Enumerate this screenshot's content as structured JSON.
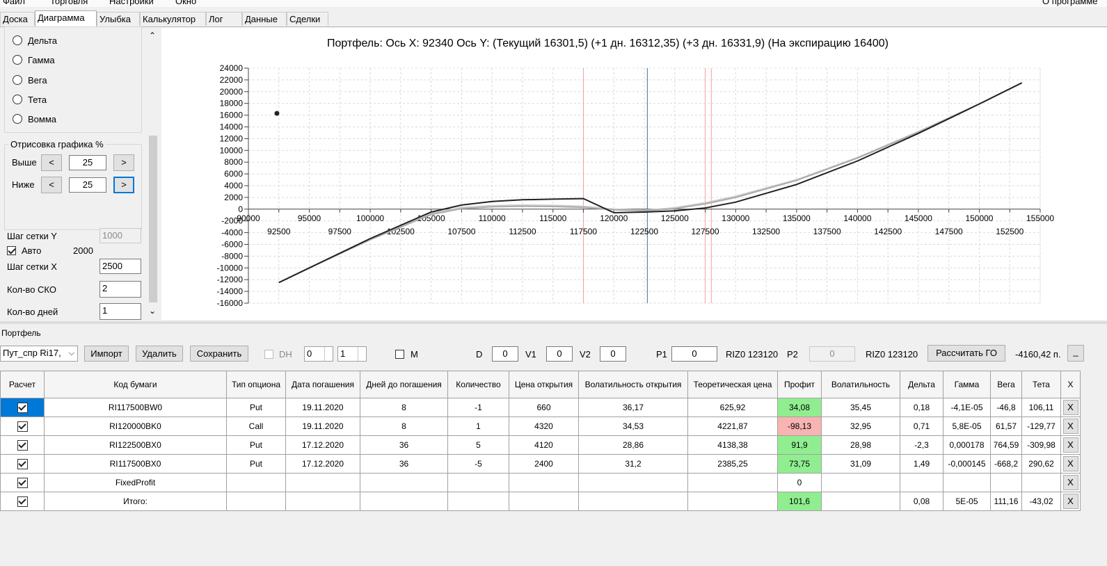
{
  "menu": {
    "file": "Файл",
    "trade": "Торговля",
    "settings": "Настройки",
    "window": "Окно",
    "about": "О программе"
  },
  "tabs": [
    "Доска",
    "Диаграмма",
    "Улыбка",
    "Калькулятор",
    "Лог",
    "Данные",
    "Сделки"
  ],
  "active_tab": "Диаграмма",
  "left": {
    "radios": [
      "Дельта",
      "Гамма",
      "Вега",
      "Тета",
      "Вомма"
    ],
    "render_group": "Отрисовка графика %",
    "above_label": "Выше",
    "below_label": "Ниже",
    "above_value": "25",
    "below_value": "25",
    "prev": "<",
    "next": ">",
    "grid_y_label": "Шаг сетки Y",
    "grid_y_value": "1000",
    "auto_label": "Авто",
    "auto_value": "2000",
    "grid_x_label": "Шаг сетки X",
    "grid_x_value": "2500",
    "sko_label": "Кол-во СКО",
    "sko_value": "2",
    "days_label": "Кол-во дней",
    "days_value": "1"
  },
  "chart": {
    "title": "Портфель: Ось X: 92340 Ось Y:  (Текущий 16301,5)  (+1 дн. 16312,35)  (+3 дн. 16331,9)  (На экспирацию 16400)"
  },
  "chart_data": {
    "type": "line",
    "title": "Портфель: Ось X: 92340 Ось Y:  (Текущий 16301,5)  (+1 дн. 16312,35)  (+3 дн. 16331,9)  (На экспирацию 16400)",
    "xlim": [
      90000,
      155000
    ],
    "ylim": [
      -16000,
      24000
    ],
    "x_ticks_top": [
      90000,
      95000,
      100000,
      105000,
      110000,
      115000,
      120000,
      125000,
      130000,
      135000,
      140000,
      145000,
      150000,
      155000
    ],
    "x_ticks_bottom": [
      92500,
      97500,
      102500,
      107500,
      112500,
      117500,
      122500,
      127500,
      132500,
      137500,
      142500,
      147500,
      152500
    ],
    "y_ticks": [
      24000,
      22000,
      20000,
      18000,
      16000,
      14000,
      12000,
      10000,
      8000,
      6000,
      4000,
      2000,
      0,
      -2000,
      -4000,
      -6000,
      -8000,
      -10000,
      -12000,
      -14000,
      -16000
    ],
    "grid": true,
    "point": {
      "x": 92340,
      "y": 16301.5
    },
    "vlines": [
      {
        "x": 117500,
        "color": "#f4a0a0"
      },
      {
        "x": 122750,
        "color": "#4a6d9c"
      },
      {
        "x": 127500,
        "color": "#f4a0a0"
      },
      {
        "x": 128000,
        "color": "#f4a0a0"
      }
    ],
    "series": [
      {
        "color": "#222222",
        "x": [
          92500,
          95000,
          100000,
          105000,
          107500,
          110000,
          112500,
          115000,
          117500,
          120000,
          122500,
          125000,
          127500,
          130000,
          135000,
          140000,
          145000,
          150000,
          153500
        ],
        "y": [
          -12500,
          -10000,
          -5000,
          -500,
          700,
          1300,
          1600,
          1700,
          1800,
          -600,
          -500,
          -300,
          200,
          1200,
          4200,
          8200,
          12900,
          17900,
          21500
        ]
      },
      {
        "color": "#aaaaaa",
        "x": [
          92500,
          95000,
          100000,
          105000,
          107500,
          110000,
          112500,
          115000,
          117500,
          120000,
          122500,
          125000,
          127500,
          130000,
          135000,
          140000,
          145000,
          150000,
          153500
        ],
        "y": [
          -12500,
          -10000,
          -5200,
          -900,
          100,
          400,
          500,
          450,
          300,
          -100,
          -300,
          100,
          900,
          2000,
          4900,
          8700,
          13100,
          17900,
          21500
        ]
      },
      {
        "color": "#cfcfcf",
        "x": [
          92500,
          95000,
          100000,
          105000,
          107500,
          110000,
          112500,
          115000,
          117500,
          120000,
          122500,
          125000,
          127500,
          130000,
          135000,
          140000,
          145000,
          150000,
          153500
        ],
        "y": [
          -12500,
          -10000,
          -5100,
          -700,
          300,
          600,
          700,
          650,
          500,
          0,
          -200,
          250,
          1100,
          2200,
          5000,
          8800,
          13200,
          17900,
          21500
        ]
      }
    ]
  },
  "portfolio": {
    "group_label": "Портфель",
    "select_value": "Пут_спр Ri17,",
    "import": "Импорт",
    "delete": "Удалить",
    "save": "Сохранить",
    "dh_label": "DH",
    "dh_a": "0",
    "dh_b": "1",
    "m_label": "M",
    "d_label": "D",
    "d_value": "0",
    "v1_label": "V1",
    "v1_value": "0",
    "v2_label": "V2",
    "v2_value": "0",
    "p1_label": "P1",
    "p1_value": "0",
    "riz1": "RIZ0 123120",
    "p2_label": "P2",
    "p2_value": "0",
    "riz2": "RIZ0 123120",
    "calc_go": "Рассчитать ГО",
    "go_value": "-4160,42 п.",
    "more": "_"
  },
  "table": {
    "headers": [
      "Расчет",
      "Код бумаги",
      "Тип опциона",
      "Дата погашения",
      "Дней до погашения",
      "Количество",
      "Цена открытия",
      "Волатильность открытия",
      "Теоретическая цена",
      "Профит",
      "Волатильность",
      "Дельта",
      "Гамма",
      "Вега",
      "Тета",
      "X"
    ],
    "rows": [
      {
        "code": "RI117500BW0",
        "type": "Put",
        "date": "19.11.2020",
        "days": "8",
        "qty": "-1",
        "price": "660",
        "vol_open": "36,17",
        "theo": "625,92",
        "profit": "34,08",
        "profit_color": "green",
        "vol": "35,45",
        "delta": "0,18",
        "gamma": "-4,1E-05",
        "vega": "-46,8",
        "theta": "106,11",
        "x": "X"
      },
      {
        "code": "RI120000BK0",
        "type": "Call",
        "date": "19.11.2020",
        "days": "8",
        "qty": "1",
        "price": "4320",
        "vol_open": "34,53",
        "theo": "4221,87",
        "profit": "-98,13",
        "profit_color": "red",
        "vol": "32,95",
        "delta": "0,71",
        "gamma": "5,8E-05",
        "vega": "61,57",
        "theta": "-129,77",
        "x": "X"
      },
      {
        "code": "RI122500BX0",
        "type": "Put",
        "date": "17.12.2020",
        "days": "36",
        "qty": "5",
        "price": "4120",
        "vol_open": "28,86",
        "theo": "4138,38",
        "profit": "91,9",
        "profit_color": "green",
        "vol": "28,98",
        "delta": "-2,3",
        "gamma": "0,000178",
        "vega": "764,59",
        "theta": "-309,98",
        "x": "X"
      },
      {
        "code": "RI117500BX0",
        "type": "Put",
        "date": "17.12.2020",
        "days": "36",
        "qty": "-5",
        "price": "2400",
        "vol_open": "31,2",
        "theo": "2385,25",
        "profit": "73,75",
        "profit_color": "green",
        "vol": "31,09",
        "delta": "1,49",
        "gamma": "-0,000145",
        "vega": "-668,2",
        "theta": "290,62",
        "x": "X"
      },
      {
        "code": "FixedProfit",
        "type": "",
        "date": "",
        "days": "",
        "qty": "",
        "price": "",
        "vol_open": "",
        "theo": "",
        "profit": "0",
        "profit_color": "",
        "vol": "",
        "delta": "",
        "gamma": "",
        "vega": "",
        "theta": "",
        "x": "X"
      },
      {
        "code": "Итого:",
        "type": "",
        "date": "",
        "days": "",
        "qty": "",
        "price": "",
        "vol_open": "",
        "theo": "",
        "profit": "101,6",
        "profit_color": "green",
        "vol": "",
        "delta": "0,08",
        "gamma": "5E-05",
        "vega": "111,16",
        "theta": "-43,02",
        "x": "X"
      }
    ]
  }
}
